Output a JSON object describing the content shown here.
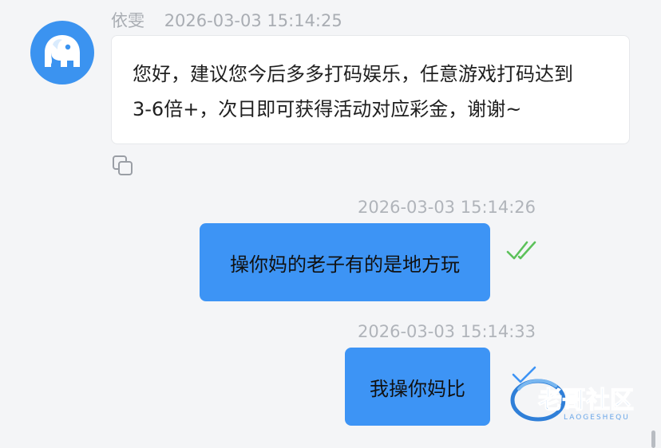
{
  "incoming": {
    "sender_name": "依雯",
    "timestamp": "2026-03-03 15:14:25",
    "message_line1": "您好，建议您今后多多打码娱乐，任意游戏打码达到",
    "message_line2": "3-6倍+，次日即可获得活动对应彩金，谢谢~",
    "avatar_icon": "elephant-icon",
    "copy_icon": "copy-icon"
  },
  "outgoing": [
    {
      "timestamp": "2026-03-03 15:14:26",
      "text": "操你妈的老子有的是地方玩",
      "status": "read",
      "status_icon": "double-check-icon",
      "status_color": "#5cc15a"
    },
    {
      "timestamp": "2026-03-03 15:14:33",
      "text": "我操你妈比",
      "status": "sent",
      "status_icon": "single-check-icon",
      "status_color": "#3d94f5"
    }
  ],
  "watermark": {
    "text": "老哥社区",
    "subtext": "LAOGESHEQU"
  },
  "colors": {
    "accent": "#3d94f5",
    "avatar_bg": "#3b93f0",
    "background": "#f4f5f7"
  }
}
